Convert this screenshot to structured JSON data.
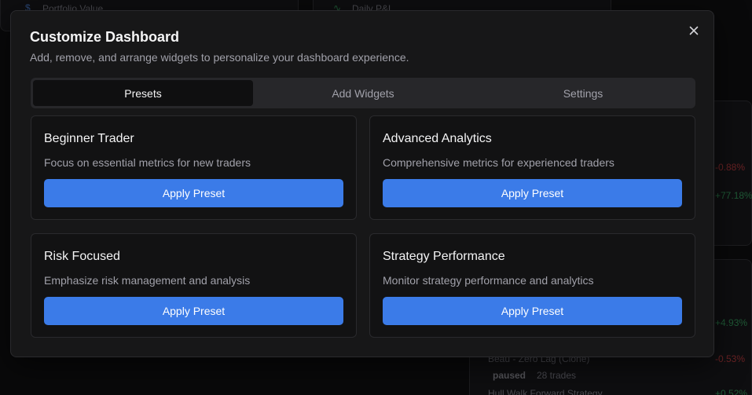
{
  "background": {
    "card1_label": "Portfolio Value",
    "card2_label": "Daily P&L",
    "right_values": [
      "-0.88%",
      "+77.18%",
      "+4.93%",
      "-0.53%",
      "+0.52%"
    ],
    "strategy_name": "Beau - Zero Lag (Clone)",
    "strategy_status": "paused",
    "strategy_trades": "28 trades",
    "strategy2_name": "Hull Walk Forward Strategy"
  },
  "modal": {
    "title": "Customize Dashboard",
    "subtitle": "Add, remove, and arrange widgets to personalize your dashboard experience.",
    "tabs": [
      "Presets",
      "Add Widgets",
      "Settings"
    ],
    "active_tab": "Presets",
    "presets": [
      {
        "title": "Beginner Trader",
        "description": "Focus on essential metrics for new traders",
        "button": "Apply Preset"
      },
      {
        "title": "Advanced Analytics",
        "description": "Comprehensive metrics for experienced traders",
        "button": "Apply Preset"
      },
      {
        "title": "Risk Focused",
        "description": "Emphasize risk management and analysis",
        "button": "Apply Preset"
      },
      {
        "title": "Strategy Performance",
        "description": "Monitor strategy performance and analytics",
        "button": "Apply Preset"
      }
    ]
  },
  "colors": {
    "accent": "#3b7be8",
    "modal_bg": "#171718",
    "positive": "#22c55e",
    "negative": "#ef4444"
  },
  "icons": [
    "dollar-icon",
    "activity-icon",
    "close-icon"
  ]
}
